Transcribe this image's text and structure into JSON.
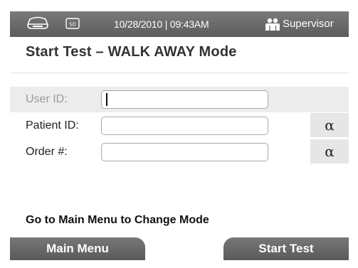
{
  "status_bar": {
    "drive_icon": "hard-drive-icon",
    "sd_icon": "sd-card-icon",
    "sd_text": "SD",
    "datetime": "10/28/2010 | 09:43AM",
    "user_icon": "users-icon",
    "role": "Supervisor"
  },
  "page": {
    "title": "Start Test – WALK AWAY Mode"
  },
  "form": {
    "user_id": {
      "label": "User ID:",
      "value": ""
    },
    "patient_id": {
      "label": "Patient ID:",
      "value": "",
      "alpha_label": "α"
    },
    "order_num": {
      "label": "Order #:",
      "value": "",
      "alpha_label": "α"
    }
  },
  "note": "Go to Main Menu to Change Mode",
  "buttons": {
    "main_menu": "Main Menu",
    "start_test": "Start Test"
  },
  "colors": {
    "bar": "#666666",
    "disabled_row": "#ececec",
    "alpha_button": "#e6e6e6"
  }
}
